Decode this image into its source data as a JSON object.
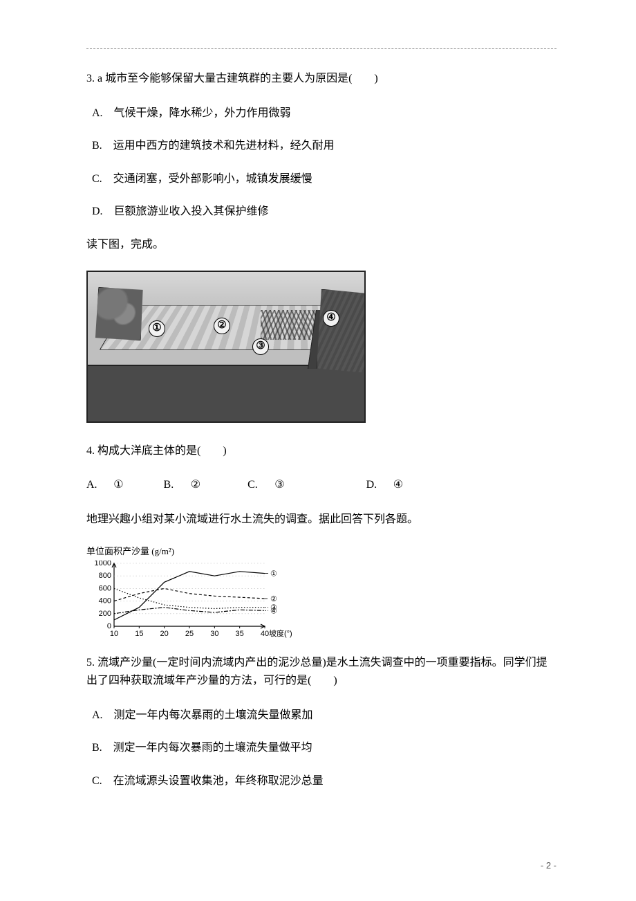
{
  "q3": {
    "stem": "3. a 城市至今能够保留大量古建筑群的主要人为原因是(　　)",
    "A": "A.　气候干燥，降水稀少，外力作用微弱",
    "B": "B.　运用中西方的建筑技术和先进材料，经久耐用",
    "C": "C.　交通闭塞，受外部影响小，城镇发展缓慢",
    "D": "D.　巨额旅游业收入投入其保护维修"
  },
  "intro_q4": "读下图，完成。",
  "fig1": {
    "labels": [
      "①",
      "②",
      "③",
      "④"
    ]
  },
  "q4": {
    "stem": "4. 构成大洋底主体的是(　　)",
    "A_lbl": "A.",
    "A_val": "①",
    "B_lbl": "B.",
    "B_val": "②",
    "C_lbl": "C.",
    "C_val": "③",
    "D_lbl": "D.",
    "D_val": "④"
  },
  "intro_q5": "地理兴趣小组对某小流域进行水土流失的调查。据此回答下列各题。",
  "q5": {
    "stem": "5. 流域产沙量(一定时间内流域内产出的泥沙总量)是水土流失调查中的一项重要指标。同学们提出了四种获取流域年产沙量的方法，可行的是(　　)",
    "A": "A.　测定一年内每次暴雨的土壤流失量做累加",
    "B": "B.　测定一年内每次暴雨的土壤流失量做平均",
    "C": "C.　在流域源头设置收集池，年终称取泥沙总量"
  },
  "page_label": "- 2 -",
  "chart_data": {
    "type": "line",
    "title": "单位面积产沙量 (g/m²)",
    "xlabel": "坡度(°)",
    "ylabel": "单位面积产沙量 (g/m²)",
    "x": [
      10,
      15,
      20,
      25,
      30,
      35,
      40
    ],
    "series": [
      {
        "name": "①",
        "values": [
          100,
          300,
          700,
          870,
          800,
          870,
          840
        ]
      },
      {
        "name": "②",
        "values": [
          400,
          520,
          600,
          520,
          480,
          460,
          440
        ]
      },
      {
        "name": "③",
        "values": [
          600,
          450,
          340,
          300,
          280,
          300,
          300
        ]
      },
      {
        "name": "④",
        "values": [
          200,
          260,
          300,
          250,
          220,
          260,
          250
        ]
      }
    ],
    "xlim": [
      10,
      40
    ],
    "ylim": [
      0,
      1000
    ],
    "yticks": [
      0,
      200,
      400,
      600,
      800,
      1000
    ],
    "xticks": [
      10,
      15,
      20,
      25,
      30,
      35,
      40
    ]
  }
}
